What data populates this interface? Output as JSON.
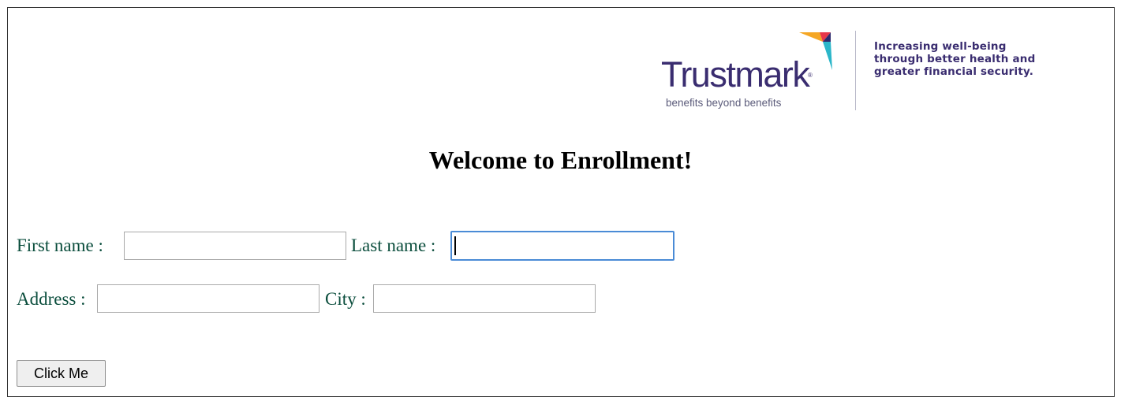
{
  "logo": {
    "wordmark": "Trustmark",
    "trademark": "®",
    "tagline": "benefits beyond benefits",
    "claim_lines": [
      "Increasing well-being",
      "through better health and",
      "greater financial security."
    ],
    "colors": {
      "wordmark": "#3a2d70",
      "mark_orange": "#f5a623",
      "mark_red": "#e8374a",
      "mark_navy": "#2d2a6e",
      "mark_teal": "#2bb6c9"
    }
  },
  "page": {
    "title": "Welcome to Enrollment!"
  },
  "form": {
    "first_name_label": "First name :",
    "first_name_value": "",
    "last_name_label": "Last name :",
    "last_name_value": "",
    "address_label": "Address :",
    "address_value": "",
    "city_label": "City :",
    "city_value": "",
    "submit_label": "Click Me"
  }
}
